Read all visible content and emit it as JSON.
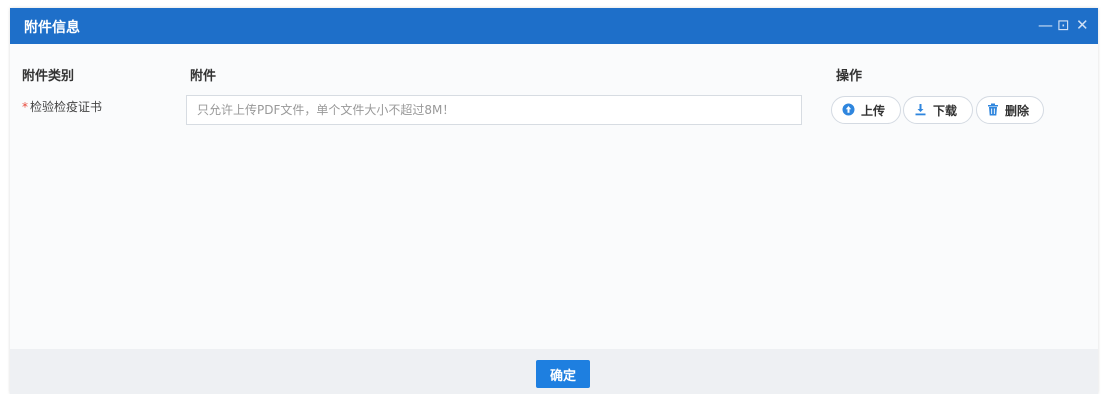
{
  "dialog": {
    "title": "附件信息",
    "controls": {
      "minimize": "—",
      "maximize": "⊡",
      "close": "✕"
    }
  },
  "table": {
    "headers": [
      "附件类别",
      "附件",
      "操作"
    ],
    "rows": [
      {
        "required_mark": "*",
        "category": "检验检疫证书",
        "file_placeholder": "只允许上传PDF文件，单个文件大小不超过8M！",
        "actions": [
          {
            "label": "上传",
            "icon": "upload-circle-icon"
          },
          {
            "label": "下载",
            "icon": "download-icon"
          },
          {
            "label": "删除",
            "icon": "trash-icon"
          }
        ]
      }
    ]
  },
  "footer": {
    "confirm_label": "确定"
  },
  "colors": {
    "titlebar": "#1e6fc9",
    "accent": "#2f86de",
    "required": "#e84a3c"
  }
}
